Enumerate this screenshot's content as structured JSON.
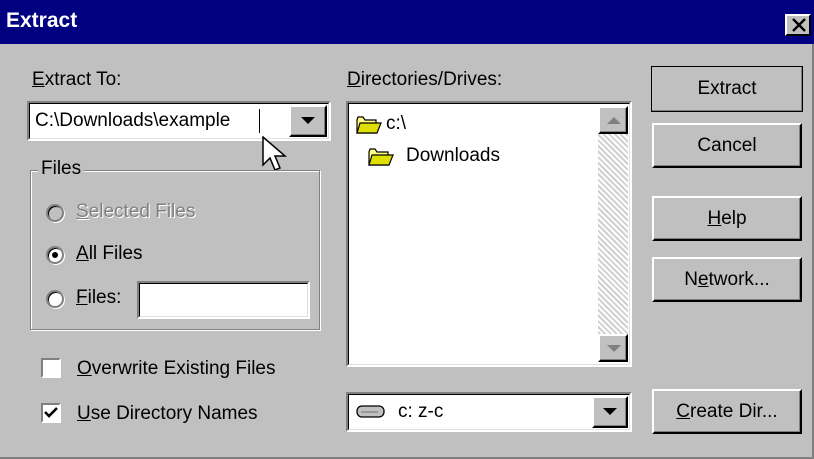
{
  "window": {
    "title": "Extract",
    "close_glyph": "×"
  },
  "extract_to": {
    "label": "Extract To:",
    "value": "C:\\Downloads\\example"
  },
  "files_group": {
    "title": "Files",
    "options": [
      {
        "label": "Selected Files",
        "enabled": false,
        "selected": false
      },
      {
        "label": "All Files",
        "enabled": true,
        "selected": true
      },
      {
        "label": "Files:",
        "enabled": true,
        "selected": false
      }
    ],
    "files_value": ""
  },
  "checkboxes": {
    "overwrite": {
      "label": "Overwrite Existing Files",
      "checked": false
    },
    "use_dir_names": {
      "label": "Use Directory Names",
      "checked": true
    }
  },
  "directories": {
    "label": "Directories/Drives:",
    "tree": [
      {
        "label": "c:\\",
        "icon": "open-folder-icon",
        "indent": 0
      },
      {
        "label": "Downloads",
        "icon": "open-folder-icon",
        "indent": 1
      }
    ]
  },
  "drive_select": {
    "value": "c: z-c",
    "icon": "drive-icon"
  },
  "buttons": {
    "extract": "Extract",
    "cancel": "Cancel",
    "help": "Help",
    "network": "Network...",
    "create_dir": "Create Dir..."
  }
}
